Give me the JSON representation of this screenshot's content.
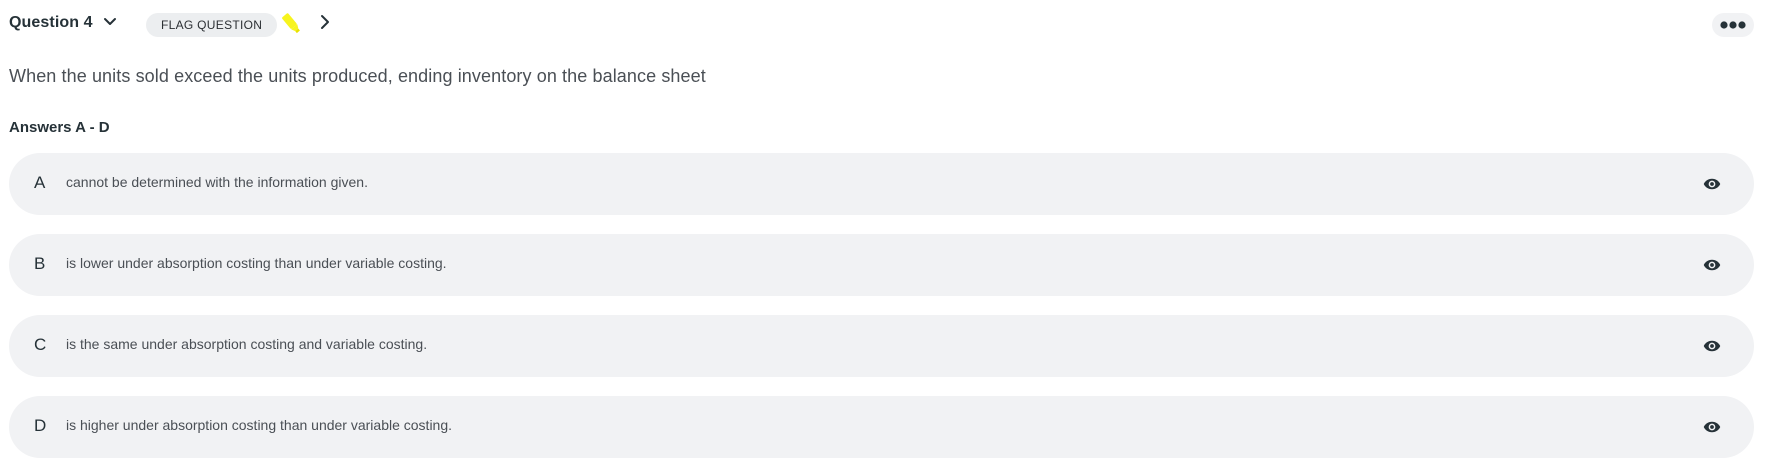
{
  "header": {
    "question_label": "Question 4",
    "flag_button_label": "FLAG QUESTION",
    "icons": {
      "dropdown": "chevron-down-icon",
      "highlighter": "highlighter-icon",
      "next": "chevron-right-icon",
      "more": "more-horizontal-icon"
    },
    "highlighter_color": "#f7f41e"
  },
  "question": {
    "text": "When the units sold exceed the units produced, ending inventory on the balance sheet"
  },
  "answers_label": "Answers A - D",
  "answers": [
    {
      "letter": "A",
      "text": "cannot be determined with the information given.",
      "icon": "eye-icon"
    },
    {
      "letter": "B",
      "text": "is lower under absorption costing than under variable costing.",
      "icon": "eye-icon"
    },
    {
      "letter": "C",
      "text": "is the same under absorption costing and variable costing.",
      "icon": "eye-icon"
    },
    {
      "letter": "D",
      "text": "is higher under absorption costing than under variable costing.",
      "icon": "eye-icon"
    }
  ],
  "colors": {
    "answer_background": "#f1f2f4",
    "flag_background": "#eceef0",
    "text_dark": "#263238",
    "text_muted": "#4a4f55"
  }
}
